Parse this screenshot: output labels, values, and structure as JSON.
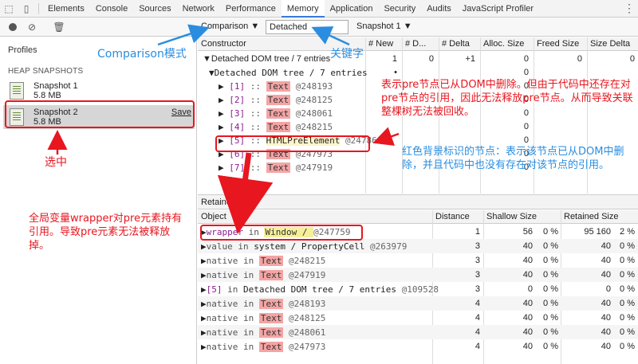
{
  "tabs": [
    "Elements",
    "Console",
    "Sources",
    "Network",
    "Performance",
    "Memory",
    "Application",
    "Security",
    "Audits",
    "JavaScript Profiler"
  ],
  "active_tab": "Memory",
  "toolbar": {
    "view": "Comparison ▼",
    "filter_value": "Detached",
    "snapshot": "Snapshot 1 ▼"
  },
  "sidebar": {
    "title": "Profiles",
    "section": "HEAP SNAPSHOTS",
    "snapshots": [
      {
        "name": "Snapshot 1",
        "size": "5.8 MB"
      },
      {
        "name": "Snapshot 2",
        "size": "5.8 MB",
        "action": "Save"
      }
    ]
  },
  "comparison_table": {
    "columns": [
      "Constructor",
      "# New",
      "# D...",
      "# Delta",
      "Alloc. Size",
      "Freed Size",
      "Size Delta"
    ],
    "rows": [
      {
        "arrow": "▼",
        "label": "Detached DOM tree / 7 entries",
        "new": "1",
        "deleted": "0",
        "delta": "+1",
        "alloc": "0",
        "freed": "0",
        "size_delta": "0"
      },
      {
        "arrow": "▼",
        "label": "Detached DOM tree / 7 entries",
        "new": "•",
        "deleted": "",
        "delta": "",
        "alloc": "0",
        "freed": "",
        "size_delta": ""
      },
      {
        "arrow": "▶",
        "idx": "[1]",
        "sep": " :: ",
        "cls": "Text",
        "addr": " @248193",
        "alloc": "0"
      },
      {
        "arrow": "▶",
        "idx": "[2]",
        "sep": " :: ",
        "cls": "Text",
        "addr": " @248125",
        "alloc": "0"
      },
      {
        "arrow": "▶",
        "idx": "[3]",
        "sep": " :: ",
        "cls": "Text",
        "addr": " @248061",
        "alloc": "0"
      },
      {
        "arrow": "▶",
        "idx": "[4]",
        "sep": " :: ",
        "cls": "Text",
        "addr": " @248215",
        "alloc": "0"
      },
      {
        "arrow": "▶",
        "idx": "[5]",
        "sep": " :: ",
        "cls": "HTMLPreElement",
        "addr": " @24786",
        "alloc": "0"
      },
      {
        "arrow": "▶",
        "idx": "[6]",
        "sep": " :: ",
        "cls": "Text",
        "addr": " @247973",
        "alloc": "0"
      },
      {
        "arrow": "▶",
        "idx": "[7]",
        "sep": " :: ",
        "cls": "Text",
        "addr": " @247919",
        "alloc": "0"
      }
    ]
  },
  "retainers": {
    "title": "Retainers",
    "columns": [
      "Object",
      "Distance",
      "Shallow Size",
      "Retained Size"
    ],
    "rows": [
      {
        "prefix": "▶",
        "prop": "wrapper",
        "in": " in ",
        "owner": "Window / ",
        "addr": "@247759",
        "distance": "1",
        "shallow": "56",
        "shallow_pct": "0 %",
        "retained": "95 160",
        "retained_pct": "2 %"
      },
      {
        "prefix": "▶",
        "prop": "value",
        "in": " in ",
        "owner": "system / PropertyCell ",
        "addr": "@263979",
        "distance": "3",
        "shallow": "40",
        "shallow_pct": "0 %",
        "retained": "40",
        "retained_pct": "0 %"
      },
      {
        "prefix": "▶",
        "prop": "native",
        "in": " in ",
        "owner": "Text",
        "addr": " @248215",
        "distance": "3",
        "shallow": "40",
        "shallow_pct": "0 %",
        "retained": "40",
        "retained_pct": "0 %"
      },
      {
        "prefix": "▶",
        "prop": "native",
        "in": " in ",
        "owner": "Text",
        "addr": " @247919",
        "distance": "3",
        "shallow": "40",
        "shallow_pct": "0 %",
        "retained": "40",
        "retained_pct": "0 %"
      },
      {
        "prefix": "▶",
        "prop": "[5]",
        "in": " in ",
        "owner": "Detached DOM tree / 7 entries ",
        "addr": "@109528",
        "distance": "3",
        "shallow": "0",
        "shallow_pct": "0 %",
        "retained": "0",
        "retained_pct": "0 %"
      },
      {
        "prefix": "▶",
        "prop": "native",
        "in": " in ",
        "owner": "Text",
        "addr": " @248193",
        "distance": "4",
        "shallow": "40",
        "shallow_pct": "0 %",
        "retained": "40",
        "retained_pct": "0 %"
      },
      {
        "prefix": "▶",
        "prop": "native",
        "in": " in ",
        "owner": "Text",
        "addr": " @248125",
        "distance": "4",
        "shallow": "40",
        "shallow_pct": "0 %",
        "retained": "40",
        "retained_pct": "0 %"
      },
      {
        "prefix": "▶",
        "prop": "native",
        "in": " in ",
        "owner": "Text",
        "addr": " @248061",
        "distance": "4",
        "shallow": "40",
        "shallow_pct": "0 %",
        "retained": "40",
        "retained_pct": "0 %"
      },
      {
        "prefix": "▶",
        "prop": "native",
        "in": " in ",
        "owner": "Text",
        "addr": " @247973",
        "distance": "4",
        "shallow": "40",
        "shallow_pct": "0 %",
        "retained": "40",
        "retained_pct": "0 %"
      }
    ]
  },
  "annotations": {
    "comparison_mode": "Comparison模式",
    "keyword": "关键字",
    "selected": "选中",
    "pre_removed": "表示pre节点已从DOM中删除。但由于代码中还存在对pre节点的引用，因此无法释放pre节点。从而导致关联整棵树无法被回收。",
    "red_bg": "红色背景标识的节点：表示该节点已从DOM中删除，并且代码中也没有存在对该节点的引用。",
    "wrapper": "全局变量wrapper对pre元素持有引用。导致pre元素无法被释放掉。"
  }
}
